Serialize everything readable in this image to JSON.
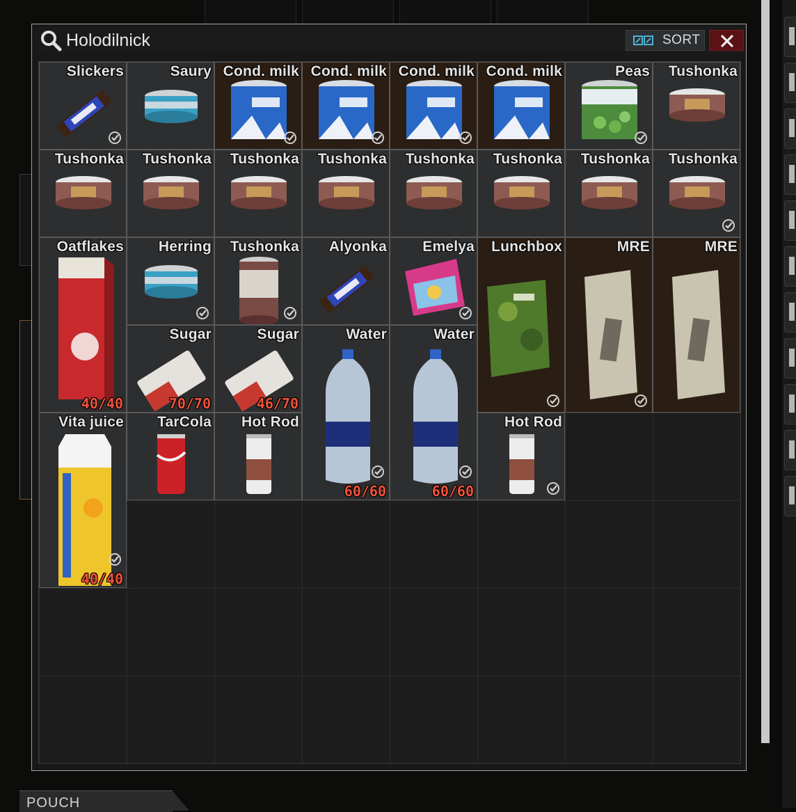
{
  "container": {
    "title": "Holodilnick",
    "sort_label": "SORT"
  },
  "items": [
    {
      "name": "Slickers",
      "icon": "chocolate-bar-icon",
      "checked": true
    },
    {
      "name": "Saury",
      "icon": "tin-can-icon",
      "checked": false
    },
    {
      "name": "Cond. milk",
      "icon": "condensed-milk-can-icon",
      "checked": true
    },
    {
      "name": "Cond. milk",
      "icon": "condensed-milk-can-icon",
      "checked": true
    },
    {
      "name": "Cond. milk",
      "icon": "condensed-milk-can-icon",
      "checked": true
    },
    {
      "name": "Cond. milk",
      "icon": "condensed-milk-can-icon",
      "checked": false
    },
    {
      "name": "Peas",
      "icon": "peas-can-icon",
      "checked": true
    },
    {
      "name": "Tushonka",
      "icon": "stew-can-icon",
      "checked": false
    },
    {
      "name": "Tushonka",
      "icon": "stew-can-icon",
      "checked": false
    },
    {
      "name": "Tushonka",
      "icon": "stew-can-icon",
      "checked": false
    },
    {
      "name": "Tushonka",
      "icon": "stew-can-icon",
      "checked": false
    },
    {
      "name": "Tushonka",
      "icon": "stew-can-icon",
      "checked": false
    },
    {
      "name": "Tushonka",
      "icon": "stew-can-icon",
      "checked": false
    },
    {
      "name": "Tushonka",
      "icon": "stew-can-icon",
      "checked": false
    },
    {
      "name": "Tushonka",
      "icon": "stew-can-icon",
      "checked": false
    },
    {
      "name": "Tushonka",
      "icon": "stew-can-icon",
      "checked": true
    },
    {
      "name": "Oatflakes",
      "icon": "oatflakes-box-icon",
      "count": "40/40",
      "checked": false
    },
    {
      "name": "Herring",
      "icon": "tin-can-icon",
      "checked": true
    },
    {
      "name": "Tushonka",
      "icon": "tall-stew-can-icon",
      "checked": true
    },
    {
      "name": "Alyonka",
      "icon": "chocolate-bar-icon",
      "checked": false
    },
    {
      "name": "Emelya",
      "icon": "crouton-pack-icon",
      "checked": true
    },
    {
      "name": "Lunchbox",
      "icon": "lunchbox-pack-icon",
      "checked": true
    },
    {
      "name": "MRE",
      "icon": "mre-pack-icon",
      "checked": true
    },
    {
      "name": "MRE",
      "icon": "mre-pack-icon",
      "checked": false
    },
    {
      "name": "Sugar",
      "icon": "sugar-pack-icon",
      "count": "70/70",
      "checked": false
    },
    {
      "name": "Sugar",
      "icon": "sugar-pack-icon",
      "count": "46/70",
      "checked": false
    },
    {
      "name": "Water",
      "icon": "water-bottle-icon",
      "count": "60/60",
      "checked": true
    },
    {
      "name": "Water",
      "icon": "water-bottle-icon",
      "count": "60/60",
      "checked": true
    },
    {
      "name": "Vita juice",
      "icon": "juice-carton-icon",
      "count": "40/40",
      "checked": true
    },
    {
      "name": "TarCola",
      "icon": "cola-can-icon",
      "checked": false
    },
    {
      "name": "Hot Rod",
      "icon": "energy-drink-icon",
      "checked": false
    },
    {
      "name": "Hot Rod",
      "icon": "energy-drink-icon",
      "checked": true
    }
  ],
  "pouch": {
    "label": "POUCH"
  },
  "colors": {
    "count_text": "#f0533a",
    "close_button": "#5c1114",
    "brown_cell": "#2a1d13",
    "grey_cell": "#2d2e2f"
  }
}
